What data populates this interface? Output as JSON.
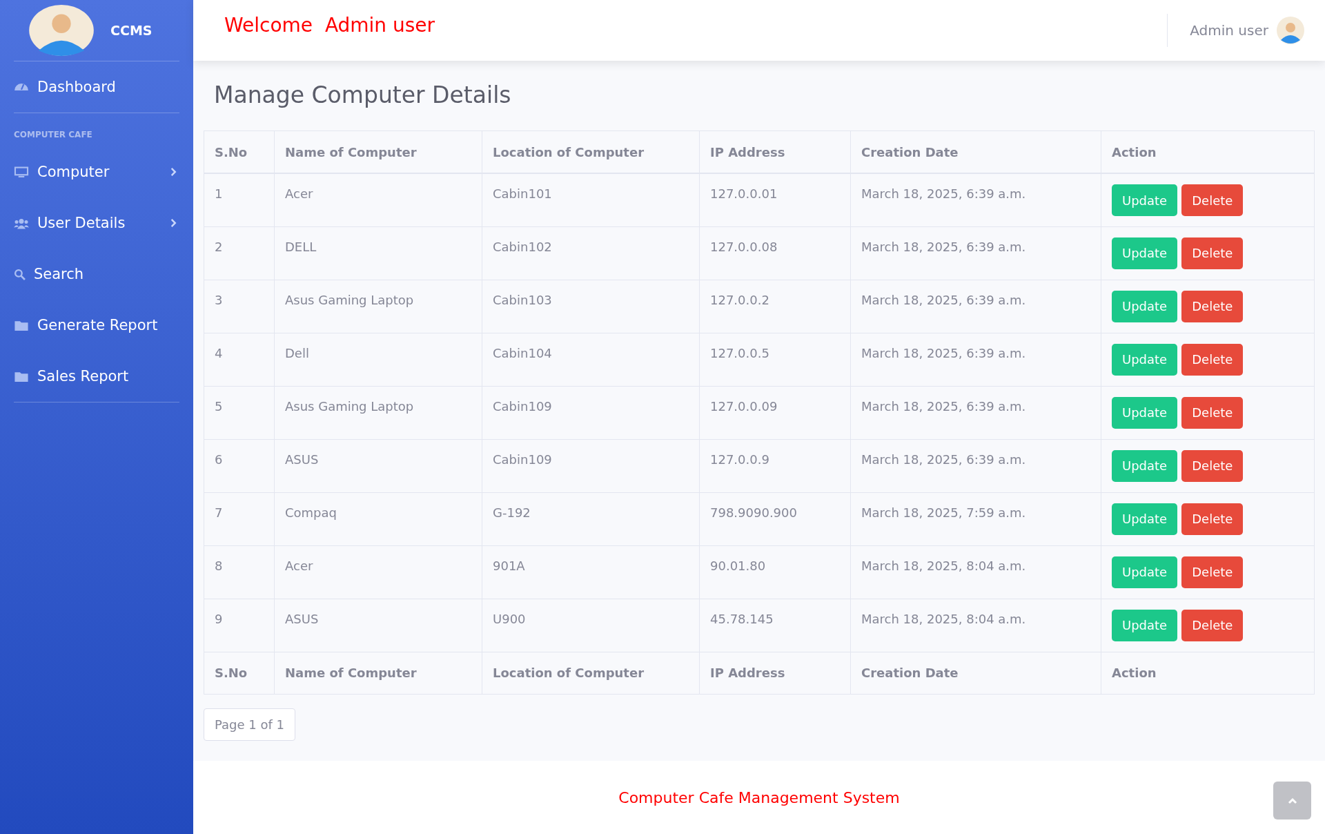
{
  "sidebar": {
    "brand": "CCMS",
    "items": [
      {
        "kind": "link",
        "label": "Dashboard",
        "expandable": false
      },
      {
        "kind": "heading",
        "label": "COMPUTER CAFE"
      },
      {
        "kind": "link",
        "label": "Computer",
        "expandable": true
      },
      {
        "kind": "link",
        "label": "User Details",
        "expandable": true
      },
      {
        "kind": "link",
        "label": "Search",
        "expandable": false
      },
      {
        "kind": "link",
        "label": "Generate Report",
        "expandable": false
      },
      {
        "kind": "link",
        "label": "Sales Report",
        "expandable": false
      }
    ]
  },
  "topbar": {
    "welcome": "Welcome  Admin user",
    "user": "Admin user"
  },
  "page_title": "Manage Computer Details",
  "table": {
    "columns": [
      "S.No",
      "Name of Computer",
      "Location of Computer",
      "IP Address",
      "Creation Date",
      "Action"
    ],
    "rows": [
      {
        "sno": "1",
        "name": "Acer",
        "location": "Cabin101",
        "ip": "127.0.0.01",
        "date": "March 18, 2025, 6:39 a.m.",
        "actions": [
          "Update",
          "Delete"
        ]
      },
      {
        "sno": "2",
        "name": "DELL",
        "location": "Cabin102",
        "ip": "127.0.0.08",
        "date": "March 18, 2025, 6:39 a.m.",
        "actions": [
          "Update",
          "Delete"
        ]
      },
      {
        "sno": "3",
        "name": "Asus Gaming Laptop",
        "location": "Cabin103",
        "ip": "127.0.0.2",
        "date": "March 18, 2025, 6:39 a.m.",
        "actions": [
          "Update",
          "Delete"
        ]
      },
      {
        "sno": "4",
        "name": "Dell",
        "location": "Cabin104",
        "ip": "127.0.0.5",
        "date": "March 18, 2025, 6:39 a.m.",
        "actions": [
          "Update",
          "Delete"
        ]
      },
      {
        "sno": "5",
        "name": "Asus Gaming Laptop",
        "location": "Cabin109",
        "ip": "127.0.0.09",
        "date": "March 18, 2025, 6:39 a.m.",
        "actions": [
          "Update",
          "Delete"
        ]
      },
      {
        "sno": "6",
        "name": "ASUS",
        "location": "Cabin109",
        "ip": "127.0.0.9",
        "date": "March 18, 2025, 6:39 a.m.",
        "actions": [
          "Update",
          "Delete"
        ]
      },
      {
        "sno": "7",
        "name": "Compaq",
        "location": "G-192",
        "ip": "798.9090.900",
        "date": "March 18, 2025, 7:59 a.m.",
        "actions": [
          "Update",
          "Delete"
        ]
      },
      {
        "sno": "8",
        "name": "Acer",
        "location": "901A",
        "ip": "90.01.80",
        "date": "March 18, 2025, 8:04 a.m.",
        "actions": [
          "Update",
          "Delete"
        ]
      },
      {
        "sno": "9",
        "name": "ASUS",
        "location": "U900",
        "ip": "45.78.145",
        "date": "March 18, 2025, 8:04 a.m.",
        "actions": [
          "Update",
          "Delete"
        ]
      }
    ],
    "footer_columns": [
      "S.No",
      "Name of Computer",
      "Location of Computer",
      "IP Address",
      "Creation Date",
      "Action"
    ]
  },
  "pagination": "Page 1 of 1",
  "footer": "Computer Cafe Management System"
}
